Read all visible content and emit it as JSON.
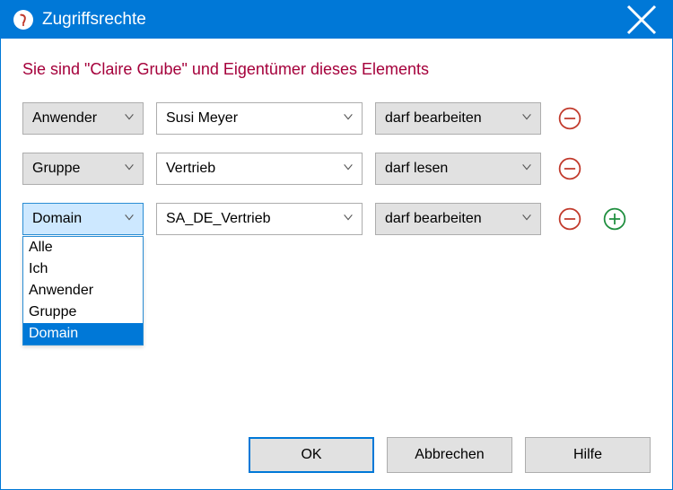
{
  "window": {
    "title": "Zugriffsrechte"
  },
  "owner_line": "Sie sind \"Claire Grube\" und Eigentümer dieses Elements",
  "rows": [
    {
      "type": "Anwender",
      "target": "Susi Meyer",
      "perm": "darf bearbeiten"
    },
    {
      "type": "Gruppe",
      "target": "Vertrieb",
      "perm": "darf lesen"
    },
    {
      "type": "Domain",
      "target": "SA_DE_Vertrieb",
      "perm": "darf bearbeiten"
    }
  ],
  "type_dropdown": {
    "options": [
      "Alle",
      "Ich",
      "Anwender",
      "Gruppe",
      "Domain"
    ],
    "selected": "Domain"
  },
  "buttons": {
    "ok": "OK",
    "cancel": "Abbrechen",
    "help": "Hilfe"
  },
  "colors": {
    "accent": "#0078D7",
    "danger_text": "#A5003B",
    "remove_icon": "#C1392B",
    "add_icon": "#1E8E3E"
  }
}
